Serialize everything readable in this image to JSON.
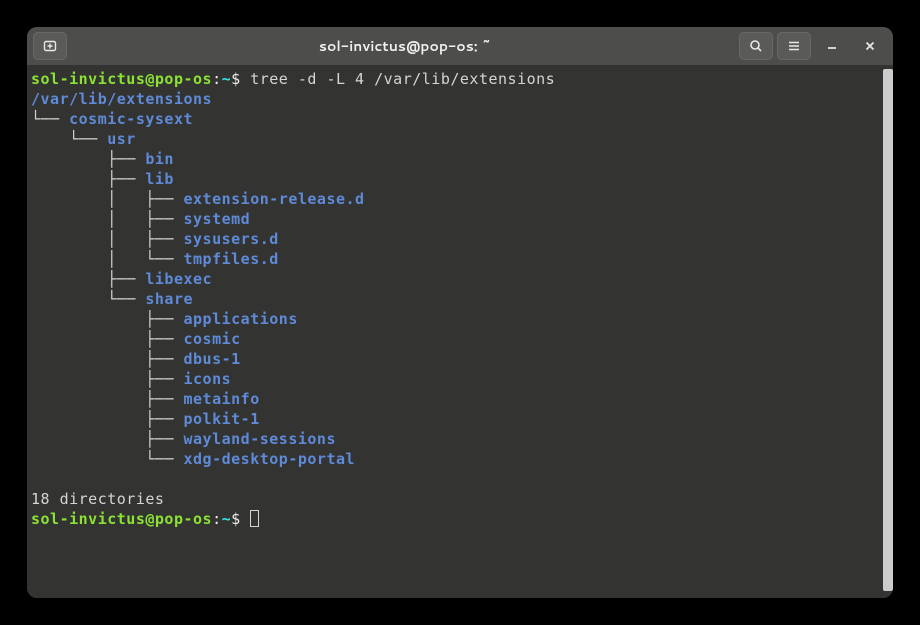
{
  "window": {
    "title": "sol-invictus@pop-os: ~"
  },
  "prompt": {
    "user_host": "sol-invictus@pop-os",
    "sep": ":",
    "path": "~",
    "sigil": "$"
  },
  "command": " tree -d -L 4 /var/lib/extensions",
  "tree": {
    "root": "/var/lib/extensions",
    "lines": [
      {
        "prefix": "└── ",
        "name": "cosmic-sysext"
      },
      {
        "prefix": "    └── ",
        "name": "usr"
      },
      {
        "prefix": "        ├── ",
        "name": "bin"
      },
      {
        "prefix": "        ├── ",
        "name": "lib"
      },
      {
        "prefix": "        │   ├── ",
        "name": "extension-release.d"
      },
      {
        "prefix": "        │   ├── ",
        "name": "systemd"
      },
      {
        "prefix": "        │   ├── ",
        "name": "sysusers.d"
      },
      {
        "prefix": "        │   └── ",
        "name": "tmpfiles.d"
      },
      {
        "prefix": "        ├── ",
        "name": "libexec"
      },
      {
        "prefix": "        └── ",
        "name": "share"
      },
      {
        "prefix": "            ├── ",
        "name": "applications"
      },
      {
        "prefix": "            ├── ",
        "name": "cosmic"
      },
      {
        "prefix": "            ├── ",
        "name": "dbus-1"
      },
      {
        "prefix": "            ├── ",
        "name": "icons"
      },
      {
        "prefix": "            ├── ",
        "name": "metainfo"
      },
      {
        "prefix": "            ├── ",
        "name": "polkit-1"
      },
      {
        "prefix": "            ├── ",
        "name": "wayland-sessions"
      },
      {
        "prefix": "            └── ",
        "name": "xdg-desktop-portal"
      }
    ],
    "summary": "18 directories"
  }
}
